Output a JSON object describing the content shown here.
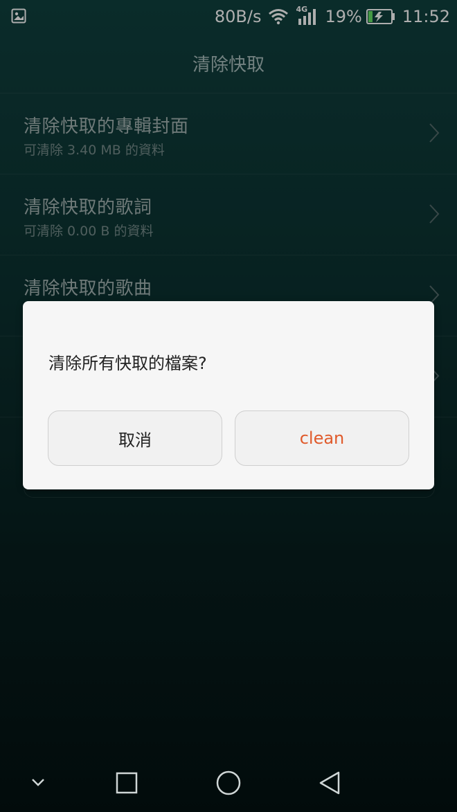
{
  "status_bar": {
    "network_speed": "80B/s",
    "network_type": "4G",
    "battery_percent": "19%",
    "time": "11:52",
    "icons": [
      "image-icon",
      "wifi-icon",
      "signal-icon",
      "battery-charging-icon"
    ]
  },
  "header": {
    "title": "清除快取"
  },
  "list": {
    "items": [
      {
        "title": "清除快取的專輯封面",
        "subtitle": "可清除 3.40 MB 的資料"
      },
      {
        "title": "清除快取的歌詞",
        "subtitle": "可清除 0.00 B 的資料"
      },
      {
        "title": "清除快取的歌曲",
        "subtitle": ""
      }
    ]
  },
  "dialog": {
    "message": "清除所有快取的檔案?",
    "cancel_label": "取消",
    "confirm_label": "clean"
  },
  "nav_bar": {
    "icons": [
      "chevron-down-icon",
      "recent-apps-icon",
      "home-icon",
      "back-icon"
    ]
  },
  "colors": {
    "accent": "#e05a2b",
    "background_top": "#0f3d3b",
    "background_bottom": "#041010"
  }
}
